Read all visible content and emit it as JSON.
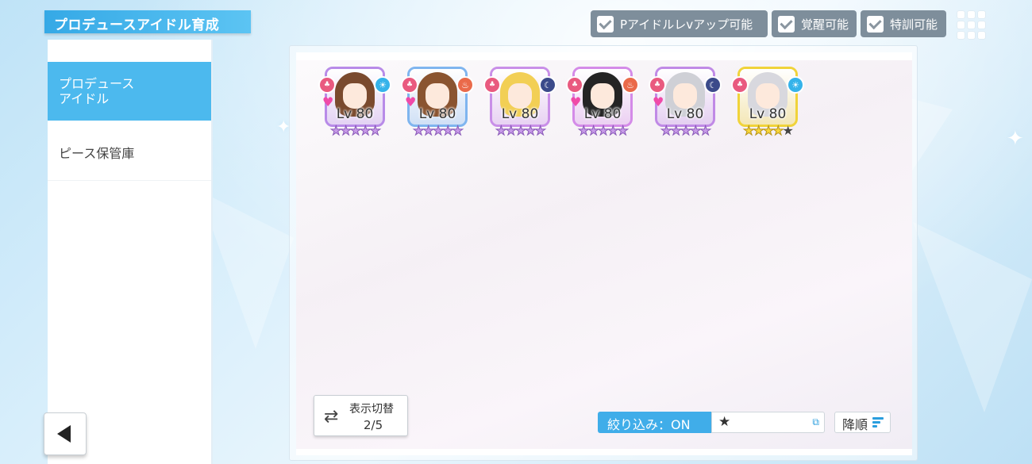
{
  "header": {
    "title": "プロデュースアイドル育成"
  },
  "sidebar": {
    "items": [
      {
        "label_line1": "プロデュース",
        "label_line2": "アイドル"
      },
      {
        "label": "ピース保管庫"
      }
    ]
  },
  "filters": {
    "p_idol_lvup": "Pアイドルレvアップ可能",
    "awaken": "覚醒可能",
    "special_training": "特訓可能"
  },
  "idols": [
    {
      "level": "Lv 80",
      "stars": "★★★★★",
      "star_style": "purple",
      "attribute": "sun",
      "hair": "#7a4a2e",
      "frame": "#b88be8"
    },
    {
      "level": "Lv 80",
      "stars": "★★★★★",
      "star_style": "purple",
      "attribute": "flame",
      "hair": "#8a5430",
      "frame": "#7fb5ef"
    },
    {
      "level": "Lv 80",
      "stars": "★★★★★",
      "star_style": "purple",
      "attribute": "moon",
      "hair": "#f2cf55",
      "frame": "#c98fe8"
    },
    {
      "level": "Lv 80",
      "stars": "★★★★★",
      "star_style": "purple",
      "attribute": "flame",
      "hair": "#242424",
      "frame": "#d48be8"
    },
    {
      "level": "Lv 80",
      "stars": "★★★★★",
      "star_style": "purple",
      "attribute": "moon",
      "hair": "#cfd0d6",
      "frame": "#c08ae6"
    },
    {
      "level": "Lv 80",
      "stars": "★★★★",
      "star_style": "yellow",
      "attribute": "sun",
      "hair": "#d8d8de",
      "frame": "#f0d33a",
      "empty_stars": "★"
    }
  ],
  "controls": {
    "toggle_label": "表示切替",
    "toggle_page": "2/5",
    "filter_label": "絞り込み：ON",
    "filter_value": "★",
    "sort_label": "降順"
  },
  "colors": {
    "accent": "#40ade9",
    "sidebar_active": "#4cb9ee",
    "filter_chip": "#7e8e9b"
  }
}
